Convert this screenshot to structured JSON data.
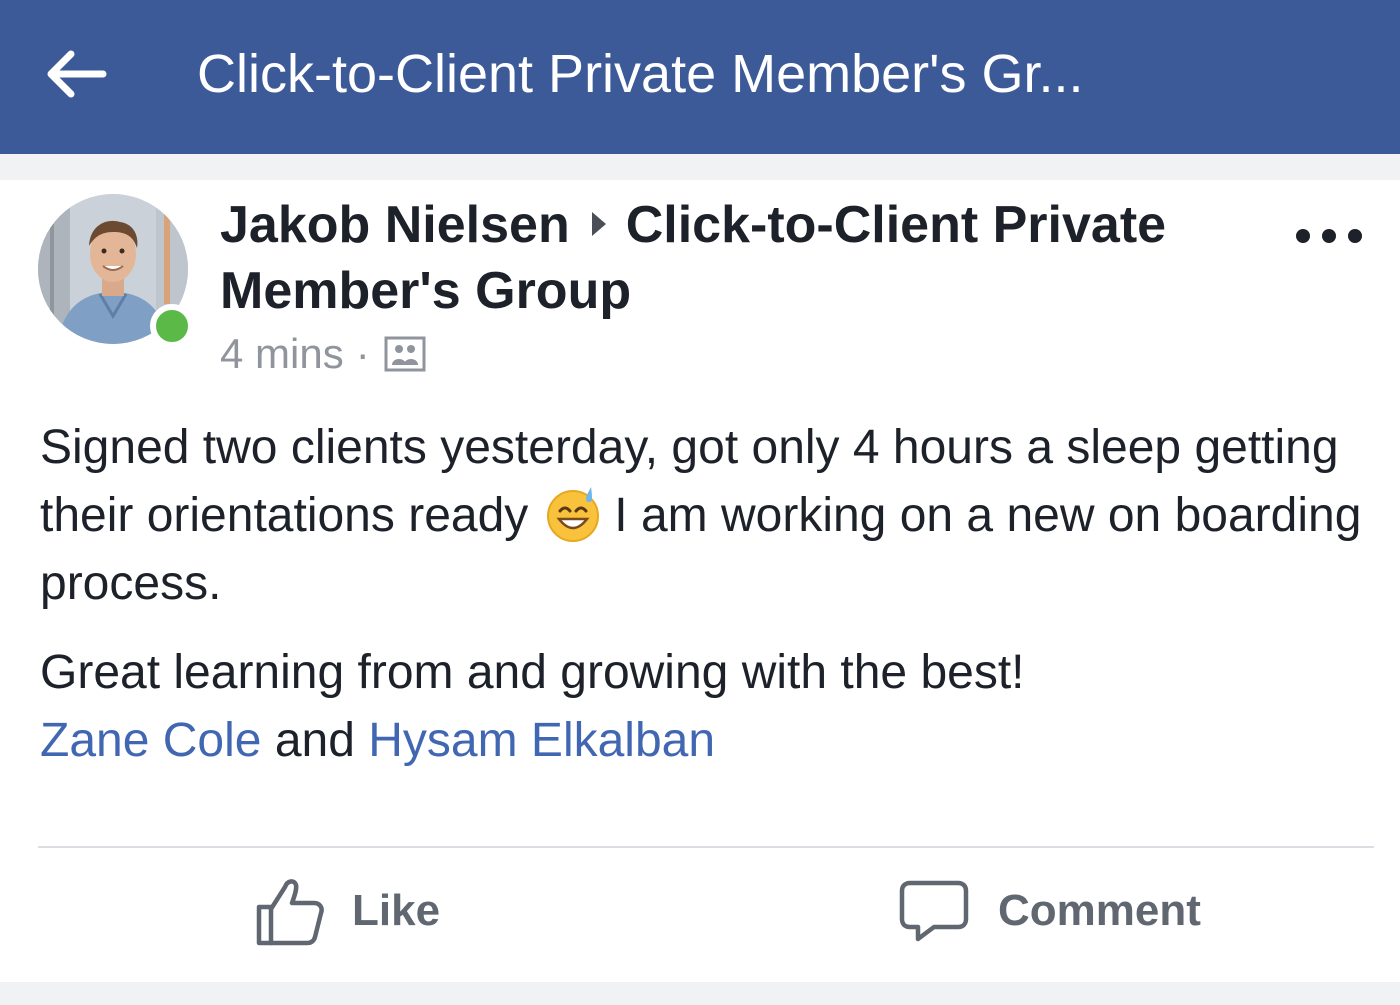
{
  "navbar": {
    "title": "Click-to-Client Private Member's Gr...",
    "back_icon": "arrow-left-icon",
    "background_color": "#3d5a98"
  },
  "post": {
    "author": "Jakob Nielsen",
    "group": "Click-to-Client Private Member's Group",
    "timestamp": "4 mins",
    "separator": "·",
    "privacy_icon": "group-members-icon",
    "more_icon": "more-options-icon",
    "online_status_color": "#5bb947",
    "body": {
      "p1_before_emoji": "Signed two clients yesterday, got only 4 hours a sleep getting their orientations ready",
      "emoji": "grinning-face-with-sweat",
      "p1_after_emoji": "I am working on a new on boarding process.",
      "p2_text": "Great learning from and growing with the best!",
      "mention_1": "Zane Cole",
      "conjunction": "and",
      "mention_2": "Hysam Elkalban"
    },
    "mention_color": "#4267b2"
  },
  "actions": {
    "like_label": "Like",
    "like_icon": "thumbs-up-icon",
    "comment_label": "Comment",
    "comment_icon": "comment-bubble-icon"
  }
}
